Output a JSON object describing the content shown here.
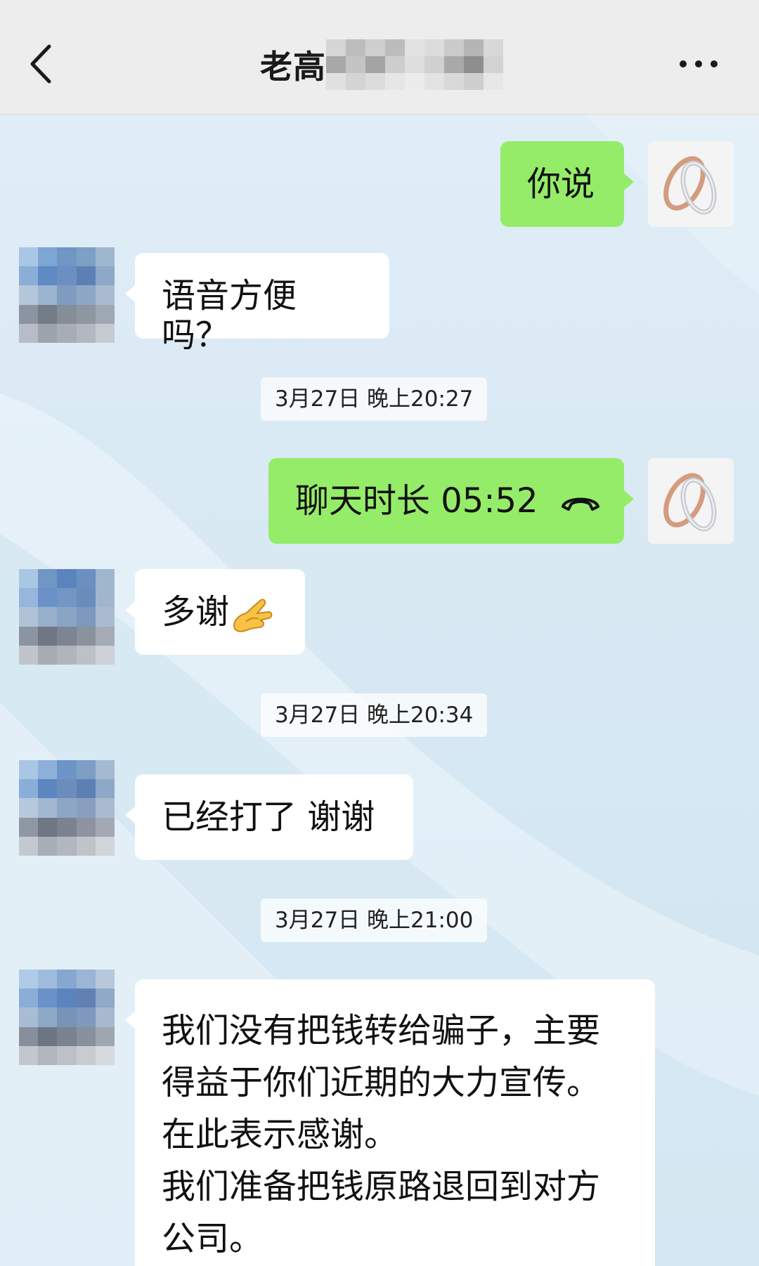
{
  "header": {
    "title": "老高",
    "back_icon": "chevron-left-icon",
    "more_icon": "more-dots-icon"
  },
  "messages": [
    {
      "side": "out",
      "text": "你说"
    },
    {
      "side": "in",
      "text": "语音方便吗？"
    },
    {
      "type": "timestamp",
      "text": "3月27日 晚上20:27"
    },
    {
      "side": "out",
      "text": "聊天时长 05:52",
      "icon": "phone-hangup-icon"
    },
    {
      "side": "in",
      "text": "多谢",
      "icon": "pinched-fingers-emoji-icon"
    },
    {
      "type": "timestamp",
      "text": "3月27日 晚上20:34"
    },
    {
      "side": "in",
      "text": "已经打了 谢谢"
    },
    {
      "type": "timestamp",
      "text": "3月27日 晚上21:00"
    },
    {
      "side": "in",
      "lines": [
        "我们没有把钱转给骗子，主要",
        "得益于你们近期的大力宣传。",
        "在此表示感谢。",
        "我们准备把钱原路退回到对方",
        "公司。"
      ]
    }
  ],
  "colors": {
    "outgoing_bubble": "#95ec69",
    "incoming_bubble": "#ffffff",
    "header_bg": "#ededed"
  }
}
